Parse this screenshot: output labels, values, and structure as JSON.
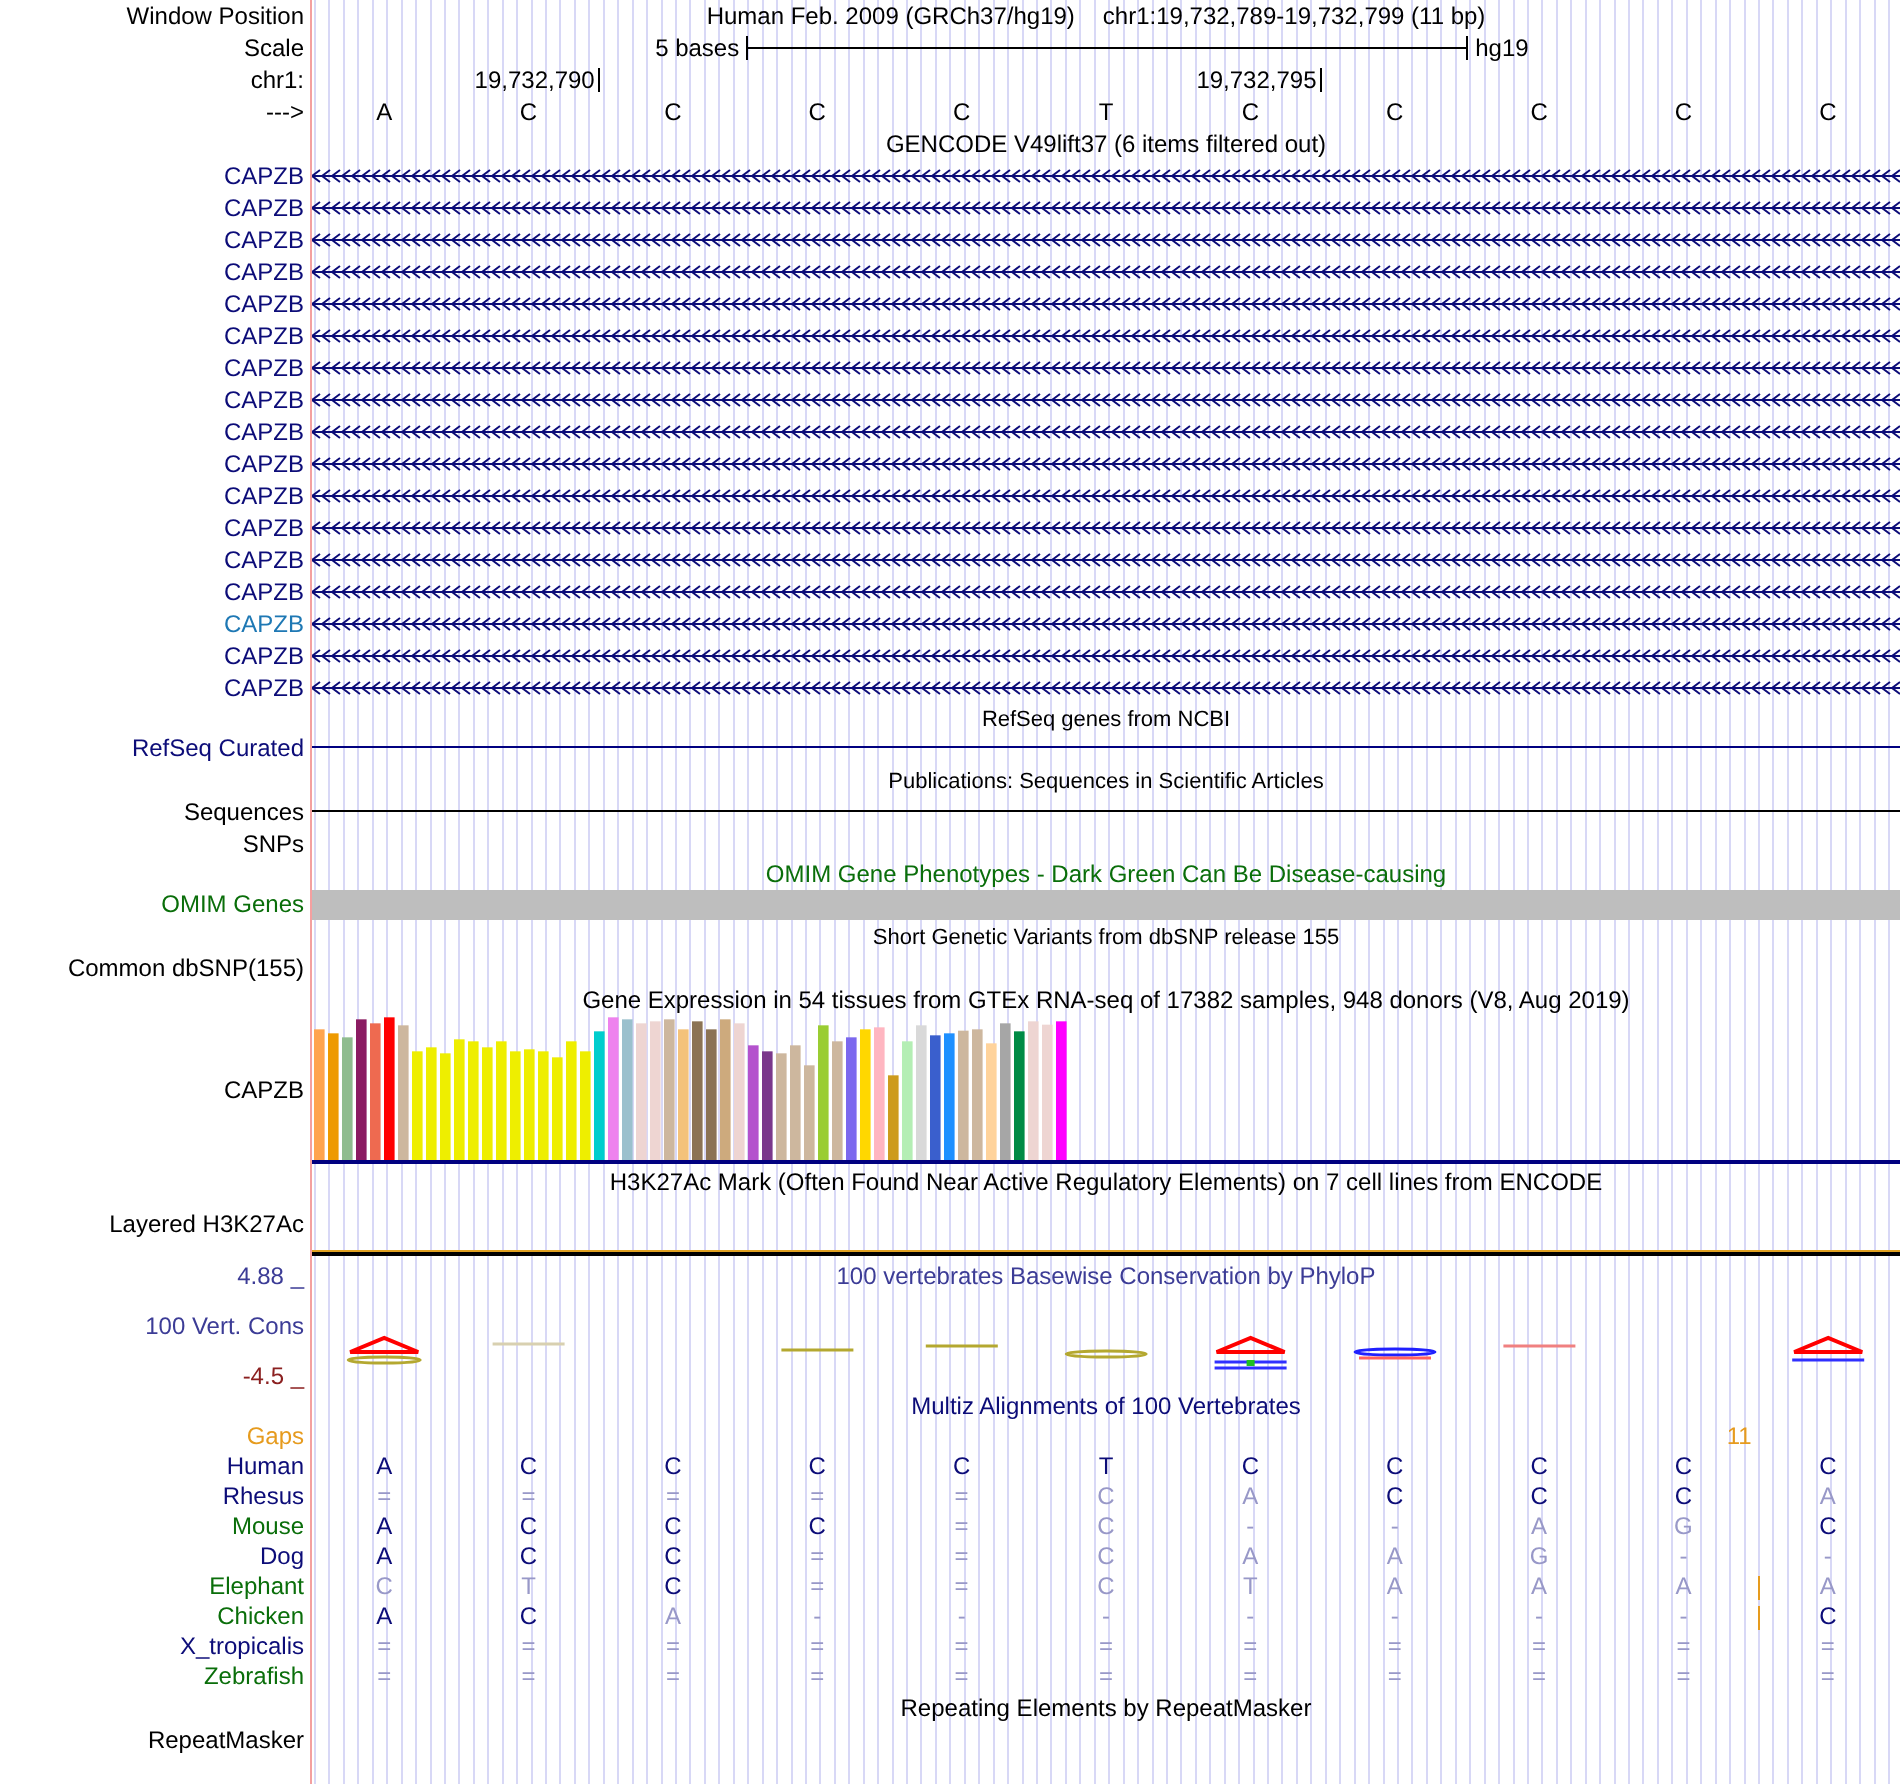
{
  "header": {
    "position_label": "Window Position",
    "assembly": "Human Feb. 2009 (GRCh37/hg19)",
    "position": "chr1:19,732,789-19,732,799 (11 bp)",
    "scale_label": "Scale",
    "scale_text": "5 bases",
    "scale_assembly": "hg19",
    "chrom_label": "chr1:",
    "ticks": [
      "19,732,790",
      "19,732,795"
    ],
    "strand_label": "--->",
    "bases": [
      "A",
      "C",
      "C",
      "C",
      "C",
      "T",
      "C",
      "C",
      "C",
      "C",
      "C"
    ]
  },
  "gencode": {
    "title": "GENCODE V49lift37 (6 items filtered out)",
    "items": [
      {
        "label": "CAPZB",
        "color": "#0c0c78"
      },
      {
        "label": "CAPZB",
        "color": "#0c0c78"
      },
      {
        "label": "CAPZB",
        "color": "#0c0c78"
      },
      {
        "label": "CAPZB",
        "color": "#0c0c78"
      },
      {
        "label": "CAPZB",
        "color": "#0c0c78"
      },
      {
        "label": "CAPZB",
        "color": "#0c0c78"
      },
      {
        "label": "CAPZB",
        "color": "#0c0c78"
      },
      {
        "label": "CAPZB",
        "color": "#0c0c78"
      },
      {
        "label": "CAPZB",
        "color": "#0c0c78"
      },
      {
        "label": "CAPZB",
        "color": "#0c0c78"
      },
      {
        "label": "CAPZB",
        "color": "#0c0c78"
      },
      {
        "label": "CAPZB",
        "color": "#0c0c78"
      },
      {
        "label": "CAPZB",
        "color": "#0c0c78"
      },
      {
        "label": "CAPZB",
        "color": "#0c0c78"
      },
      {
        "label": "CAPZB",
        "color": "#1e78b4"
      },
      {
        "label": "CAPZB",
        "color": "#0c0c78"
      },
      {
        "label": "CAPZB",
        "color": "#0c0c78"
      }
    ]
  },
  "refseq": {
    "title": "RefSeq genes from NCBI",
    "label": "RefSeq Curated"
  },
  "publications": {
    "title": "Publications: Sequences in Scientific Articles",
    "labels": [
      "Sequences",
      "SNPs"
    ]
  },
  "omim": {
    "title": "OMIM Gene Phenotypes - Dark Green Can Be Disease-causing",
    "label": "OMIM Genes"
  },
  "dbsnp": {
    "title": "Short Genetic Variants from dbSNP release 155",
    "label": "Common dbSNP(155)"
  },
  "gtex": {
    "title": "Gene Expression in 54 tissues from GTEx RNA-seq of 17382 samples, 948 donors (V8, Aug 2019)",
    "label": "CAPZB"
  },
  "h3k27ac": {
    "title": "H3K27Ac Mark (Often Found Near Active Regulatory Elements) on 7 cell lines from ENCODE",
    "label": "Layered H3K27Ac"
  },
  "conservation": {
    "title": "100 vertebrates Basewise Conservation by PhyloP",
    "label": "100 Vert. Cons",
    "max_label": "4.88 _",
    "min_label": "-4.5 _"
  },
  "multiz": {
    "title": "Multiz Alignments of 100 Vertebrates",
    "gaps_label": "Gaps",
    "gaps_count": "11",
    "species": [
      {
        "name": "Human",
        "color": "#0c0c78",
        "gap_mark": false,
        "cells": [
          {
            "text": "A",
            "faint": false
          },
          {
            "text": "C",
            "faint": false
          },
          {
            "text": "C",
            "faint": false
          },
          {
            "text": "C",
            "faint": false
          },
          {
            "text": "C",
            "faint": false
          },
          {
            "text": "T",
            "faint": false
          },
          {
            "text": "C",
            "faint": false
          },
          {
            "text": "C",
            "faint": false
          },
          {
            "text": "C",
            "faint": false
          },
          {
            "text": "C",
            "faint": false
          },
          {
            "text": "C",
            "faint": false
          }
        ]
      },
      {
        "name": "Rhesus",
        "color": "#0c0c78",
        "gap_mark": false,
        "cells": [
          {
            "text": "=",
            "faint": true
          },
          {
            "text": "=",
            "faint": true
          },
          {
            "text": "=",
            "faint": true
          },
          {
            "text": "=",
            "faint": true
          },
          {
            "text": "=",
            "faint": true
          },
          {
            "text": "C",
            "faint": true
          },
          {
            "text": "A",
            "faint": true
          },
          {
            "text": "C",
            "faint": false
          },
          {
            "text": "C",
            "faint": false
          },
          {
            "text": "C",
            "faint": false
          },
          {
            "text": "A",
            "faint": true
          }
        ]
      },
      {
        "name": "Mouse",
        "color": "#0a6e0a",
        "gap_mark": false,
        "cells": [
          {
            "text": "A",
            "faint": false
          },
          {
            "text": "C",
            "faint": false
          },
          {
            "text": "C",
            "faint": false
          },
          {
            "text": "C",
            "faint": false
          },
          {
            "text": "=",
            "faint": true
          },
          {
            "text": "C",
            "faint": true
          },
          {
            "text": "-",
            "faint": true
          },
          {
            "text": "-",
            "faint": true
          },
          {
            "text": "A",
            "faint": true
          },
          {
            "text": "G",
            "faint": true
          },
          {
            "text": "C",
            "faint": false
          }
        ]
      },
      {
        "name": "Dog",
        "color": "#0c0c78",
        "gap_mark": false,
        "cells": [
          {
            "text": "A",
            "faint": false
          },
          {
            "text": "C",
            "faint": false
          },
          {
            "text": "C",
            "faint": false
          },
          {
            "text": "=",
            "faint": true
          },
          {
            "text": "=",
            "faint": true
          },
          {
            "text": "C",
            "faint": true
          },
          {
            "text": "A",
            "faint": true
          },
          {
            "text": "A",
            "faint": true
          },
          {
            "text": "G",
            "faint": true
          },
          {
            "text": "-",
            "faint": true
          },
          {
            "text": "-",
            "faint": true
          }
        ]
      },
      {
        "name": "Elephant",
        "color": "#0a6e0a",
        "gap_mark": true,
        "cells": [
          {
            "text": "C",
            "faint": true
          },
          {
            "text": "T",
            "faint": true
          },
          {
            "text": "C",
            "faint": false
          },
          {
            "text": "=",
            "faint": true
          },
          {
            "text": "=",
            "faint": true
          },
          {
            "text": "C",
            "faint": true
          },
          {
            "text": "T",
            "faint": true
          },
          {
            "text": "A",
            "faint": true
          },
          {
            "text": "A",
            "faint": true
          },
          {
            "text": "A",
            "faint": true
          },
          {
            "text": "A",
            "faint": true
          }
        ]
      },
      {
        "name": "Chicken",
        "color": "#0a6e0a",
        "gap_mark": true,
        "cells": [
          {
            "text": "A",
            "faint": false
          },
          {
            "text": "C",
            "faint": false
          },
          {
            "text": "A",
            "faint": true
          },
          {
            "text": "-",
            "faint": true
          },
          {
            "text": "-",
            "faint": true
          },
          {
            "text": "-",
            "faint": true
          },
          {
            "text": "-",
            "faint": true
          },
          {
            "text": "-",
            "faint": true
          },
          {
            "text": "-",
            "faint": true
          },
          {
            "text": "-",
            "faint": true
          },
          {
            "text": "C",
            "faint": false
          }
        ]
      },
      {
        "name": "X_tropicalis",
        "color": "#0c0c78",
        "gap_mark": false,
        "cells": [
          {
            "text": "=",
            "faint": true
          },
          {
            "text": "=",
            "faint": true
          },
          {
            "text": "=",
            "faint": true
          },
          {
            "text": "=",
            "faint": true
          },
          {
            "text": "=",
            "faint": true
          },
          {
            "text": "=",
            "faint": true
          },
          {
            "text": "=",
            "faint": true
          },
          {
            "text": "=",
            "faint": true
          },
          {
            "text": "=",
            "faint": true
          },
          {
            "text": "=",
            "faint": true
          },
          {
            "text": "=",
            "faint": true
          }
        ]
      },
      {
        "name": "Zebrafish",
        "color": "#0a6e0a",
        "gap_mark": false,
        "cells": [
          {
            "text": "=",
            "faint": true
          },
          {
            "text": "=",
            "faint": true
          },
          {
            "text": "=",
            "faint": true
          },
          {
            "text": "=",
            "faint": true
          },
          {
            "text": "=",
            "faint": true
          },
          {
            "text": "=",
            "faint": true
          },
          {
            "text": "=",
            "faint": true
          },
          {
            "text": "=",
            "faint": true
          },
          {
            "text": "=",
            "faint": true
          },
          {
            "text": "=",
            "faint": true
          },
          {
            "text": "=",
            "faint": true
          }
        ]
      }
    ]
  },
  "repeatmasker": {
    "title": "Repeating Elements by RepeatMasker",
    "label": "RepeatMasker"
  }
}
